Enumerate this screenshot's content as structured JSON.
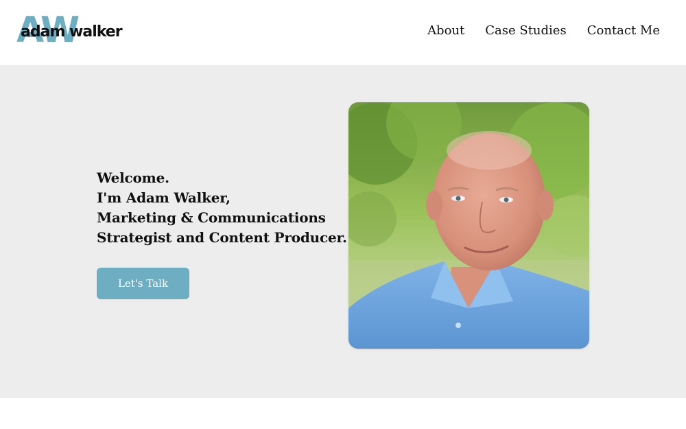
{
  "header": {
    "logo": {
      "monogram": "AW",
      "name": "adam walker"
    },
    "nav": [
      {
        "label": "About"
      },
      {
        "label": "Case Studies"
      },
      {
        "label": "Contact Me"
      }
    ]
  },
  "hero": {
    "intro_lines": [
      "Welcome.",
      "I'm Adam Walker,",
      "Marketing & Communications",
      "Strategist and Content Producer."
    ],
    "cta_label": "Let's Talk",
    "portrait": {
      "subject": "portrait photo"
    }
  },
  "colors": {
    "accent": "#6eaec3",
    "hero_background": "#ededed",
    "header_background": "#ffffff",
    "text": "#111111"
  }
}
